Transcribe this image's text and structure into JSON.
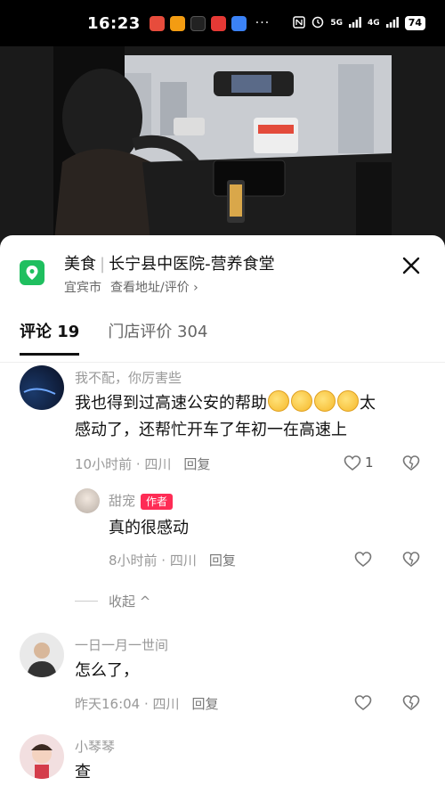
{
  "status_bar": {
    "time": "16:23",
    "more": "···",
    "signal_5g": "5G",
    "signal_4g": "4G",
    "battery": "74"
  },
  "poi": {
    "category": "美食",
    "name": "长宁县中医院-营养食堂",
    "city": "宜宾市",
    "view_link": "查看地址/评价 ›"
  },
  "tabs": [
    {
      "label": "评论 19"
    },
    {
      "label": "门店评价 304"
    }
  ],
  "comments": [
    {
      "user": "我不配，你厉害些",
      "text_part1": "我也得到过高速公安的帮助",
      "text_part2": "太",
      "text_line2": "感动了，还帮忙开车了年初一在高速上",
      "emoji_count": 4,
      "time": "10小时前 · 四川",
      "reply": "回复",
      "likes": "1"
    },
    {
      "user": "甜宠",
      "author_tag": "作者",
      "text": "真的很感动",
      "time": "8小时前 · 四川",
      "reply": "回复"
    },
    {
      "user": "一日一月一世间",
      "text": "怎么了，",
      "time": "昨天16:04 · 四川",
      "reply": "回复"
    },
    {
      "user": "小琴琴",
      "text": "查"
    }
  ],
  "collapse_label": "收起 ^"
}
